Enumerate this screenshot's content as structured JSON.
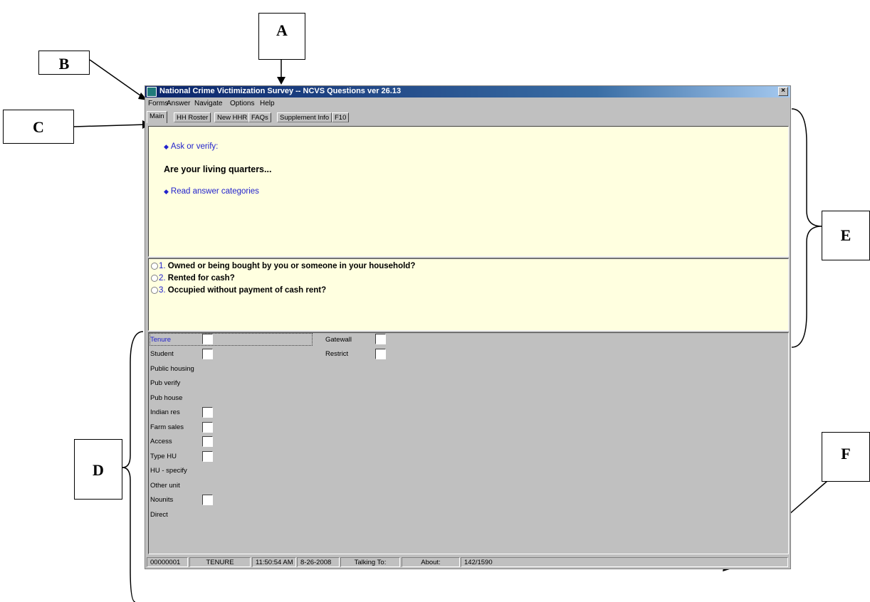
{
  "window": {
    "title": "National Crime Victimization Survey -- NCVS Questions ver 26.13",
    "close": "×"
  },
  "menu": [
    "Forms",
    "Answer",
    "Navigate",
    "Options",
    "Help"
  ],
  "tabs": [
    "Main",
    "HH Roster",
    "New HHR",
    "FAQs",
    "Supplement Info",
    "F10"
  ],
  "question_panel": {
    "instruction1": "Ask or verify:",
    "question": "Are your living quarters...",
    "instruction2": "Read answer categories"
  },
  "answers": [
    {
      "num": "1.",
      "text": "Owned or being bought by you or someone in your household?"
    },
    {
      "num": "2.",
      "text": "Rented for cash?"
    },
    {
      "num": "3.",
      "text": "Occupied without payment of cash rent?"
    }
  ],
  "fields_left": [
    "Tenure",
    "Student",
    "Public housing",
    "Pub verify",
    "Pub house",
    "Indian res",
    "Farm sales",
    "Access",
    "Type HU",
    "HU - specify",
    "Other unit",
    "Nounits",
    "Direct"
  ],
  "fields_right": [
    "Gatewall",
    "Restrict"
  ],
  "status_bar": [
    "00000001",
    "TENURE",
    "11:50:54 AM",
    "8-26-2008",
    "Talking To:",
    "About:",
    "142/1590"
  ],
  "callouts": {
    "a": "A",
    "b": "B",
    "c": "C",
    "d": "D",
    "e": "E",
    "f": "F"
  }
}
